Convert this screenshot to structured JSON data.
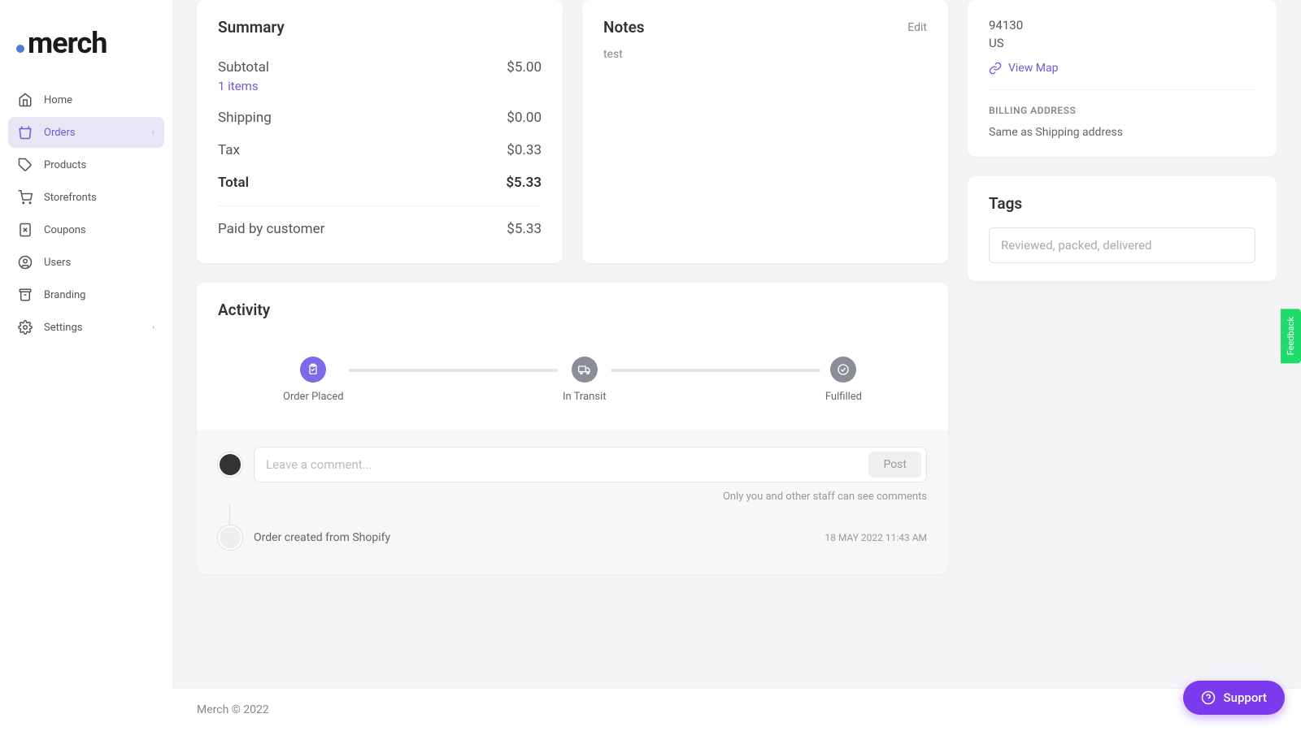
{
  "logo": "merch",
  "sidebar": {
    "items": [
      {
        "label": "Home"
      },
      {
        "label": "Orders"
      },
      {
        "label": "Products"
      },
      {
        "label": "Storefronts"
      },
      {
        "label": "Coupons"
      },
      {
        "label": "Users"
      },
      {
        "label": "Branding"
      },
      {
        "label": "Settings"
      }
    ]
  },
  "summary": {
    "title": "Summary",
    "subtotal_label": "Subtotal",
    "subtotal_value": "$5.00",
    "items_text": "1 items",
    "shipping_label": "Shipping",
    "shipping_value": "$0.00",
    "tax_label": "Tax",
    "tax_value": "$0.33",
    "total_label": "Total",
    "total_value": "$5.33",
    "paid_label": "Paid by customer",
    "paid_value": "$5.33"
  },
  "notes": {
    "title": "Notes",
    "edit": "Edit",
    "body": "test"
  },
  "address": {
    "postal": "94130",
    "country": "US",
    "view_map": "View Map",
    "billing_heading": "BILLING ADDRESS",
    "billing_text": "Same as Shipping address"
  },
  "tags": {
    "title": "Tags",
    "placeholder": "Reviewed, packed, delivered"
  },
  "activity": {
    "title": "Activity",
    "steps": [
      {
        "label": "Order Placed"
      },
      {
        "label": "In Transit"
      },
      {
        "label": "Fulfilled"
      }
    ],
    "comment_placeholder": "Leave a comment...",
    "post": "Post",
    "hint": "Only you and other staff can see comments",
    "log_text": "Order created from Shopify",
    "log_date": "18 MAY 2022 11:43 AM"
  },
  "footer": "Merch © 2022",
  "support": "Support",
  "feedback": "Feedback"
}
